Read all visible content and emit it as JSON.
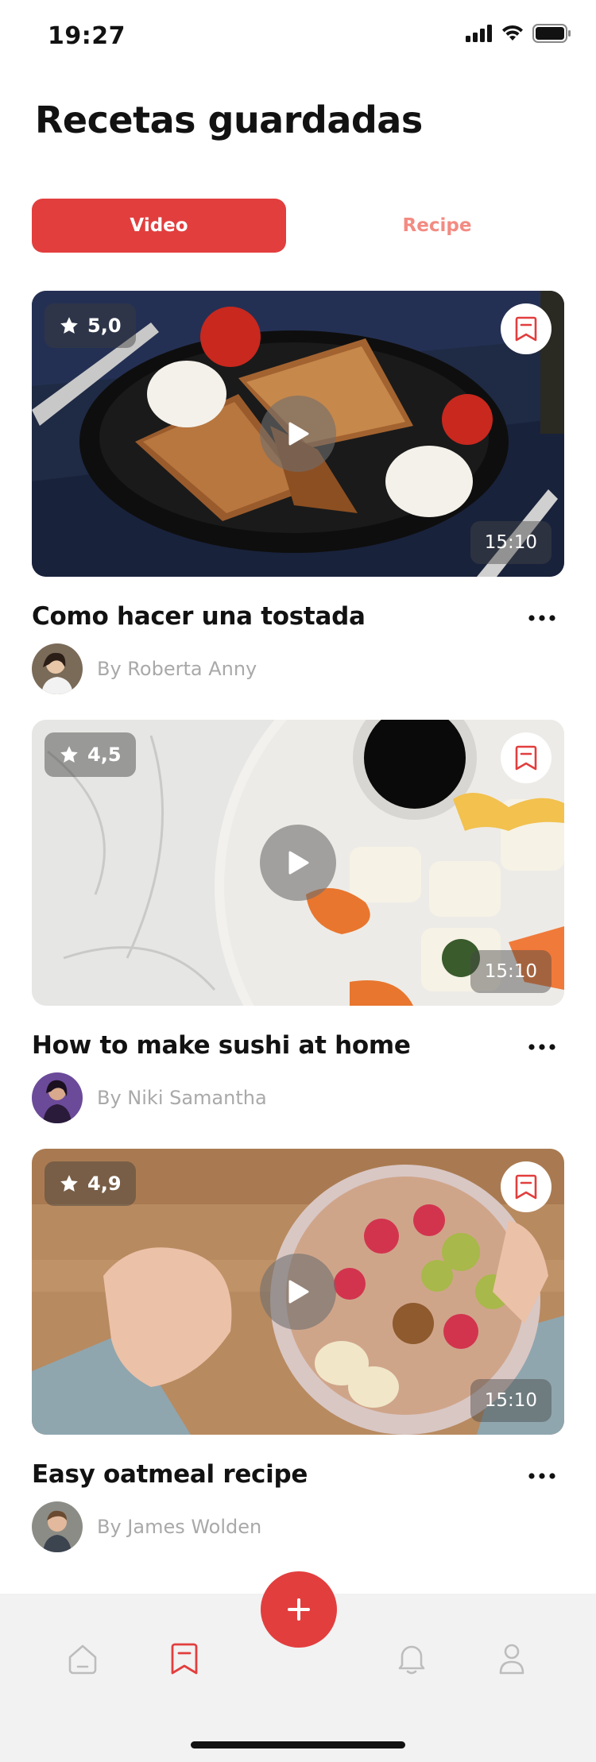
{
  "status_bar": {
    "time": "19:27"
  },
  "page": {
    "title": "Recetas guardadas"
  },
  "tabs": [
    {
      "label": "Video",
      "active": true
    },
    {
      "label": "Recipe",
      "active": false
    }
  ],
  "cards": [
    {
      "rating": "5,0",
      "duration": "15:10",
      "title": "Como hacer una tostada",
      "author": "By Roberta Anny"
    },
    {
      "rating": "4,5",
      "duration": "15:10",
      "title": "How to make sushi at home",
      "author": "By Niki Samantha"
    },
    {
      "rating": "4,9",
      "duration": "15:10",
      "title": "Easy oatmeal recipe",
      "author": "By James Wolden"
    }
  ],
  "bottom_nav": {
    "items": [
      {
        "icon": "home-icon",
        "active": false
      },
      {
        "icon": "bookmark-icon",
        "active": true
      },
      {
        "icon": "bell-icon",
        "active": false
      },
      {
        "icon": "profile-icon",
        "active": false
      }
    ],
    "fab_icon": "plus-icon"
  },
  "colors": {
    "accent": "#E23E3E",
    "accent_light": "#F28B82",
    "muted": "#A9A9A9",
    "nav_bg": "#F2F2F2"
  }
}
